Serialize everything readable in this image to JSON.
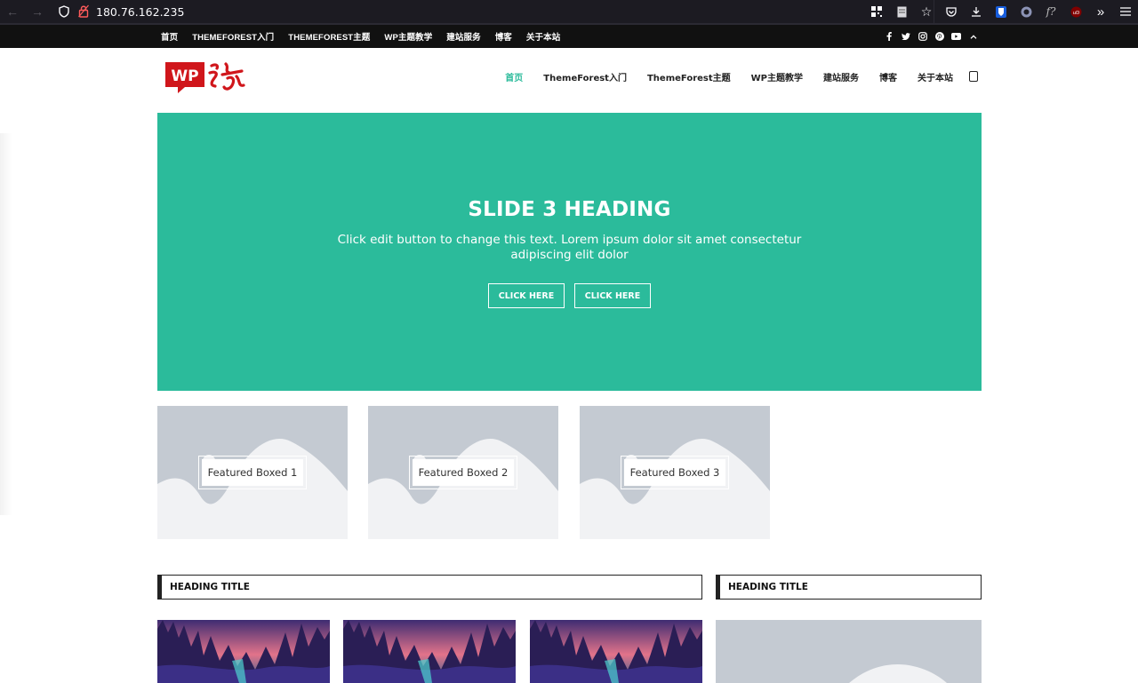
{
  "browser": {
    "url": "180.76.162.235"
  },
  "topbar": {
    "menu": [
      "首页",
      "THEMEFOREST入门",
      "THEMEFOREST主题",
      "WP主题教学",
      "建站服务",
      "博客",
      "关于本站"
    ],
    "social": [
      "facebook-icon",
      "twitter-icon",
      "instagram-icon",
      "pinterest-icon",
      "youtube-icon",
      "chevron-up-icon"
    ]
  },
  "header": {
    "logo_text": "WP",
    "nav": [
      "首页",
      "ThemeForest入门",
      "ThemeForest主题",
      "WP主题教学",
      "建站服务",
      "博客",
      "关于本站"
    ],
    "active_index": 0
  },
  "slider": {
    "heading": "SLIDE 3 HEADING",
    "text": "Click edit button to change this text. Lorem ipsum dolor sit amet consectetur adipiscing elit dolor",
    "buttons": [
      "CLICK HERE",
      "CLICK HERE"
    ]
  },
  "featured": [
    "Featured Boxed 1",
    "Featured Boxed 2",
    "Featured Boxed 3"
  ],
  "headings": [
    "HEADING TITLE",
    "HEADING TITLE"
  ],
  "colors": {
    "accent": "#2bbb9b",
    "topbar": "#111111",
    "placeholder": "#c4cad2"
  }
}
